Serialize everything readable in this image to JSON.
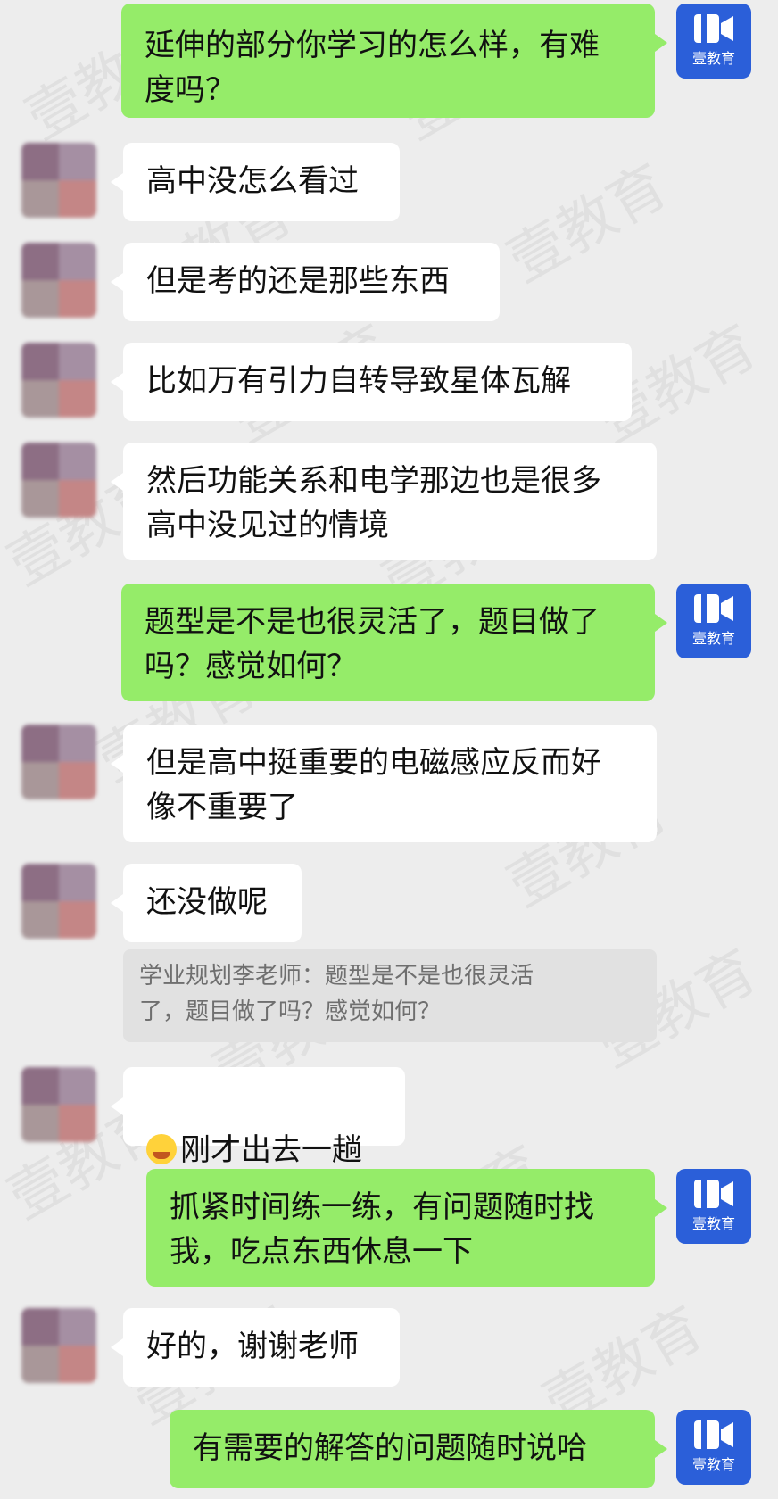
{
  "colors": {
    "background": "#ededed",
    "sent_bubble": "#95ec69",
    "received_bubble": "#ffffff",
    "quote_bg": "#e1e1e1",
    "brand_blue": "#2b5fd9"
  },
  "brand": {
    "logo_text": "壹教育",
    "watermark": "壹教育"
  },
  "messages": [
    {
      "side": "sent",
      "text": "延伸的部分你学习的怎么样，有难\n度吗？"
    },
    {
      "side": "received",
      "text": "高中没怎么看过"
    },
    {
      "side": "received",
      "text": "但是考的还是那些东西"
    },
    {
      "side": "received",
      "text": "比如万有引力自转导致星体瓦解"
    },
    {
      "side": "received",
      "text": "然后功能关系和电学那边也是很多\n高中没见过的情境"
    },
    {
      "side": "sent",
      "text": "题型是不是也很灵活了，题目做了\n吗？感觉如何？"
    },
    {
      "side": "received",
      "text": "但是高中挺重要的电磁感应反而好\n像不重要了"
    },
    {
      "side": "received",
      "text": "还没做呢"
    },
    {
      "side": "received",
      "text": "刚才出去一趟",
      "emoji": "face-with-tears-icon"
    },
    {
      "side": "sent",
      "text": "抓紧时间练一练，有问题随时找\n我，吃点东西休息一下"
    },
    {
      "side": "received",
      "text": "好的，谢谢老师"
    },
    {
      "side": "sent",
      "text": "有需要的解答的问题随时说哈"
    }
  ],
  "quote": {
    "text": "学业规划李老师：题型是不是也很灵活\n了，题目做了吗？感觉如何？"
  }
}
